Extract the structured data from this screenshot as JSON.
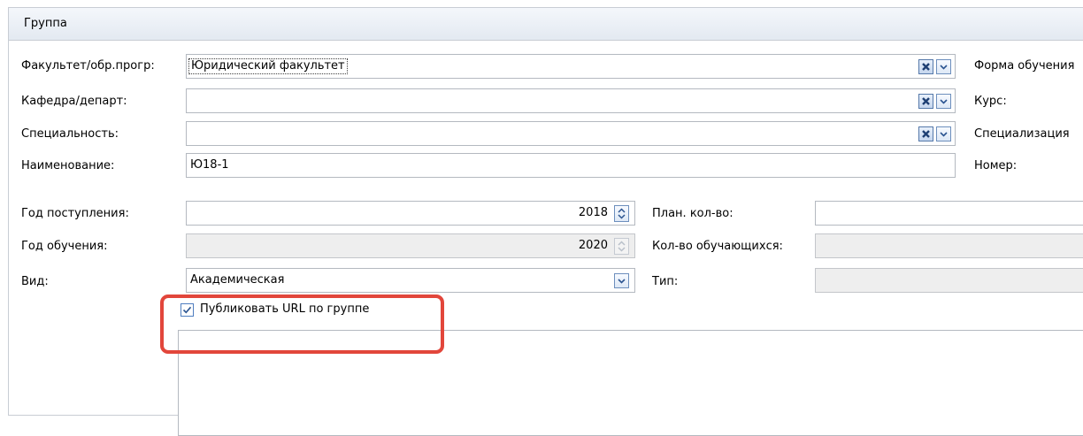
{
  "group": {
    "title": "Группа"
  },
  "labels": {
    "faculty": "Факультет/обр.прогр:",
    "department": "Кафедра/департ:",
    "specialty": "Специальность:",
    "name": "Наименование:",
    "form": "Форма обучения",
    "course": "Курс:",
    "specialization": "Специализация",
    "number": "Номер:",
    "admission_year": "Год поступления:",
    "study_year": "Год обучения:",
    "type": "Вид:",
    "planned_count": "План. кол-во:",
    "students_count": "Кол-во обучающихся:",
    "kind": "Тип:"
  },
  "values": {
    "faculty": "Юридический факультет",
    "department": "",
    "specialty": "",
    "name": "Ю18-1",
    "admission_year": "2018",
    "study_year": "2020",
    "type": "Академическая",
    "planned_count": "",
    "students_count": "",
    "kind": ""
  },
  "publish": {
    "label": "Публиковать URL по группе",
    "checked": true
  },
  "icons": {
    "clear": "clear-x-icon",
    "dropdown": "chevron-down-icon",
    "spin": "spin-updown-icon",
    "check": "checkmark-icon"
  },
  "colors": {
    "highlight": "#e2463b",
    "accent": "#4f7ec0"
  }
}
